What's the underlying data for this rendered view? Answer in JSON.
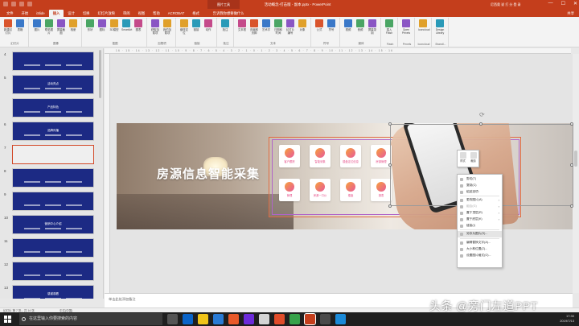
{
  "window": {
    "title": "活动概念-打击版 - 副本.pptx - PowerPoint",
    "context_tab": "图片工具",
    "user": "尼西奥 说 打 分 登 录",
    "controls": [
      "—",
      "☐",
      "✕"
    ]
  },
  "tabs": [
    "文件",
    "开始",
    "iSlide",
    "插入",
    "设计",
    "切换",
    "幻灯片放映",
    "审阅",
    "视图",
    "帮助",
    "ACROBAT",
    "格式"
  ],
  "active_tab": "插入",
  "tell_me": "告诉我你想要做什么",
  "share": "共享",
  "ribbon": {
    "groups": [
      {
        "label": "幻灯片",
        "buttons": [
          "新建幻灯片",
          "表格"
        ]
      },
      {
        "label": "图像",
        "buttons": [
          "图片",
          "联机图片",
          "屏幕截图",
          "相册"
        ]
      },
      {
        "label": "插图",
        "buttons": [
          "形状",
          "图标",
          "3D模型",
          "SmartArt",
          "图表"
        ]
      },
      {
        "label": "加载项",
        "buttons": [
          "获取加载项",
          "我的加载项"
        ]
      },
      {
        "label": "链接",
        "buttons": [
          "缩放定位",
          "链接",
          "动作"
        ]
      },
      {
        "label": "批注",
        "buttons": [
          "批注"
        ]
      },
      {
        "label": "文本",
        "buttons": [
          "文本框",
          "页眉和页脚",
          "艺术字",
          "日期和时间",
          "幻灯片编号",
          "对象"
        ]
      },
      {
        "label": "符号",
        "buttons": [
          "公式",
          "符号"
        ]
      },
      {
        "label": "媒体",
        "buttons": [
          "视频",
          "音频",
          "屏幕录制"
        ]
      },
      {
        "label": "Flash",
        "buttons": [
          "插入Flash"
        ]
      },
      {
        "label": "Pexels",
        "buttons": [
          "Open Pexels"
        ]
      },
      {
        "label": "Iconcloud",
        "buttons": [
          "Iconcloud"
        ]
      },
      {
        "label": "Brandl...",
        "buttons": [
          "Design Library"
        ]
      }
    ]
  },
  "thumbnails": [
    {
      "num": "4",
      "title": ""
    },
    {
      "num": "5",
      "title": "活动亮点"
    },
    {
      "num": "",
      "title": "产品特色"
    },
    {
      "num": "6",
      "title": "品牌传播"
    },
    {
      "num": "7",
      "title": ""
    },
    {
      "num": "8",
      "title": ""
    },
    {
      "num": "9",
      "title": ""
    },
    {
      "num": "10",
      "title": "营销中心介绍"
    },
    {
      "num": "11",
      "title": ""
    },
    {
      "num": "12",
      "title": ""
    },
    {
      "num": "13",
      "title": "感谢观看"
    }
  ],
  "active_thumbnail_index": 4,
  "ruler_text": "16 · 15 · 14 · 13 · 12 · 11 · 10 · 9 · 8 · 7 · 6 · 5 · 4 · 3 · 2 · 1 · 0 · 1 · 2 · 3 · 4 · 5 · 6 · 7 · 8 · 9 · 10 · 11 · 12 · 13 · 14 · 15 · 16",
  "slide": {
    "headline": "房源信息智能采集",
    "features": [
      {
        "label": "客户跟踪"
      },
      {
        "label": "智能采集"
      },
      {
        "label": "楼盘定位信息"
      },
      {
        "label": "房源管理"
      },
      {
        "label": "管理"
      },
      {
        "label": "房源一口价"
      },
      {
        "label": "楼盘"
      },
      {
        "label": "报表"
      }
    ]
  },
  "mini_toolbar": {
    "style_label": "样式",
    "crop_label": "裁剪"
  },
  "context_menu": [
    {
      "label": "剪切(T)",
      "dim": false
    },
    {
      "label": "复制(C)",
      "dim": false
    },
    {
      "label": "粘贴选项:",
      "dim": false
    },
    {
      "sep": true
    },
    {
      "label": "更改图片(A)",
      "dim": false,
      "arrow": true
    },
    {
      "label": "组合(G)",
      "dim": true,
      "arrow": true
    },
    {
      "label": "置于顶层(R)",
      "dim": false,
      "arrow": true
    },
    {
      "label": "置于底层(K)",
      "dim": false,
      "arrow": true
    },
    {
      "label": "链接(I)",
      "dim": false
    },
    {
      "sep": true
    },
    {
      "label": "另存为图片(S)...",
      "dim": false,
      "hl": true
    },
    {
      "sep": true
    },
    {
      "label": "编辑替换文字(A)...",
      "dim": false
    },
    {
      "label": "大小和位置(Z)...",
      "dim": false
    },
    {
      "label": "设置图片格式(O)...",
      "dim": false
    }
  ],
  "notes_placeholder": "单击此处添加备注",
  "status": {
    "slide_info": "幻灯片 第 7 张，共 14 张",
    "language": "中文(中国)"
  },
  "taskbar": {
    "search_placeholder": "在这里输入你要搜索的内容",
    "time": "17:30",
    "date": "2019/7/13"
  },
  "watermark": "头条 @旁门左道PPT",
  "colors": {
    "accent": "#c43e1c",
    "feature_text": "#e5508a",
    "frame_outer": "#e06a40",
    "frame_inner": "#b064c8"
  }
}
